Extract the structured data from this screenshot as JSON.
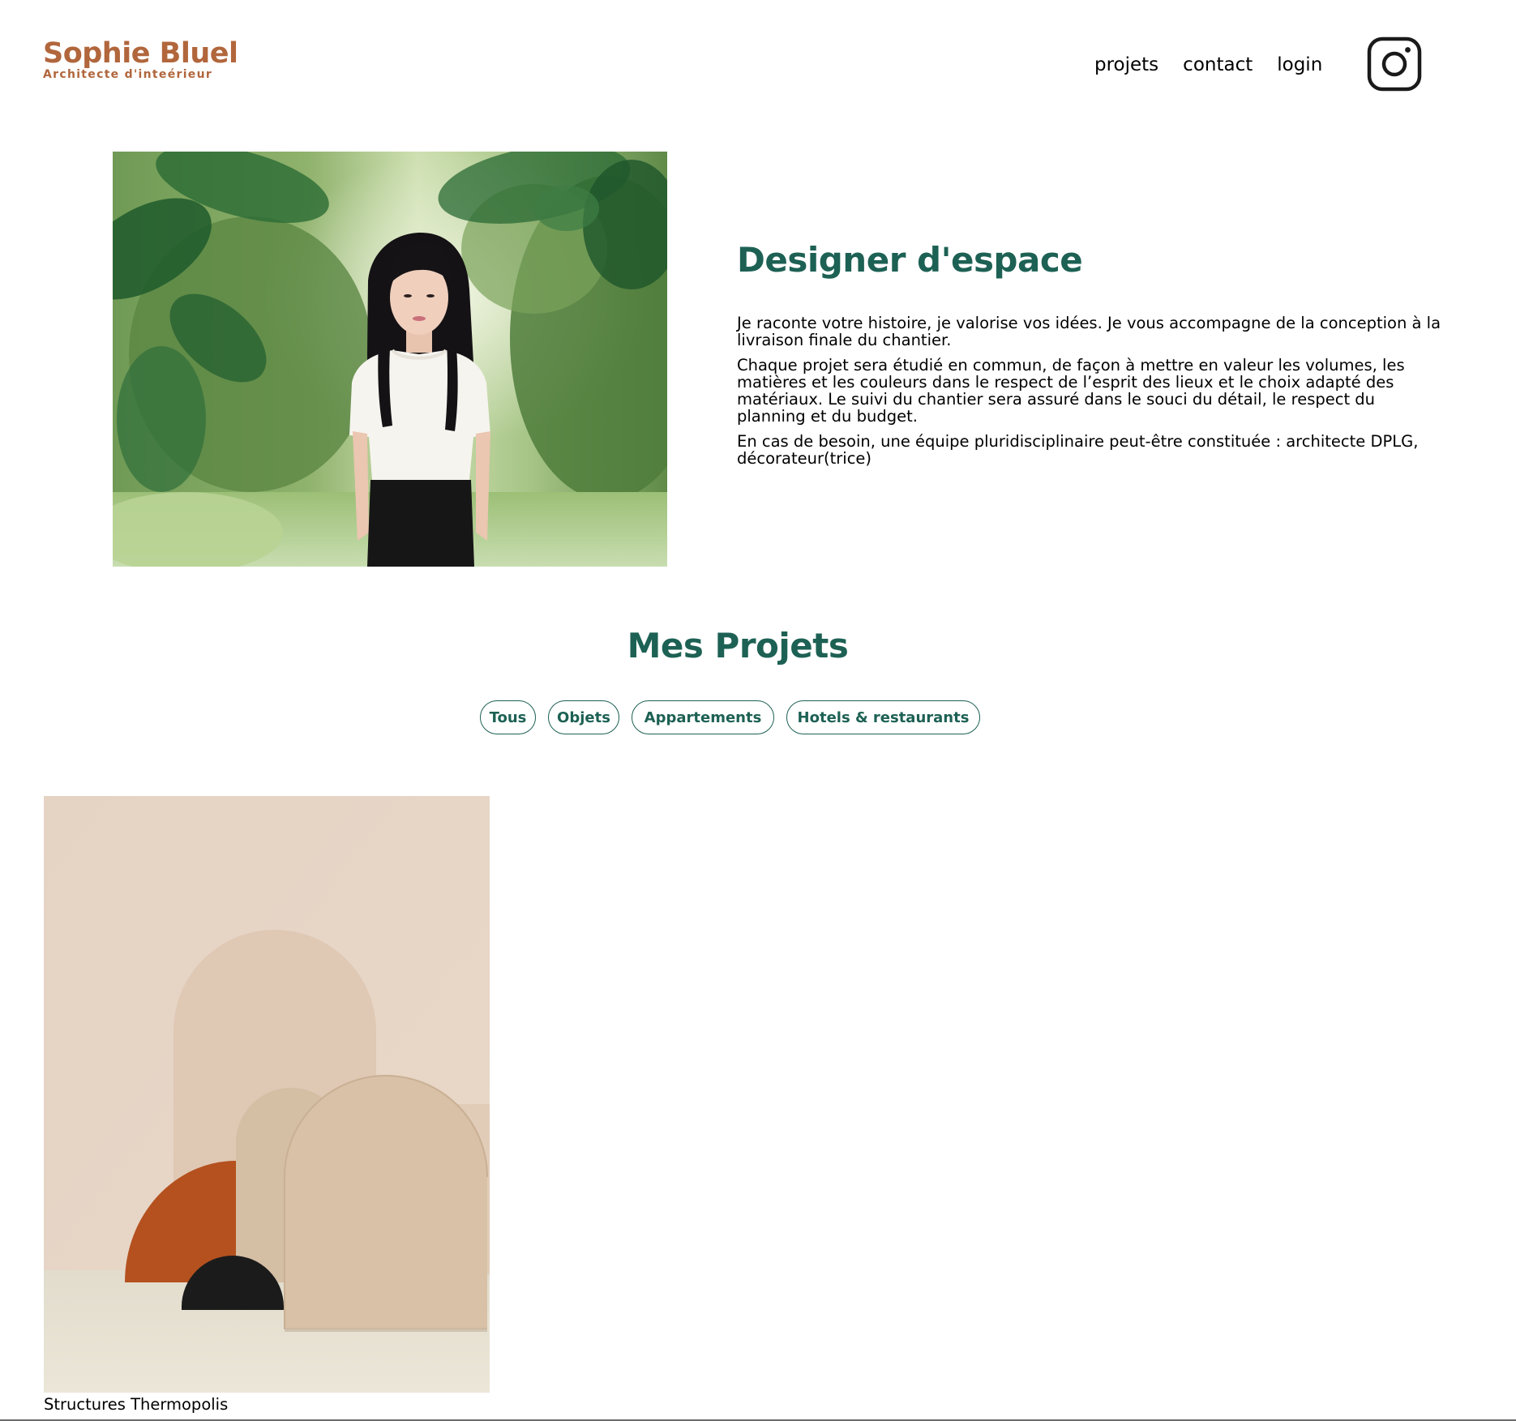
{
  "header": {
    "logo_title": "Sophie Bluel",
    "logo_subtitle": "Architecte d'inteérieur",
    "nav": [
      {
        "label": "projets"
      },
      {
        "label": "contact"
      },
      {
        "label": "login"
      }
    ],
    "social_icon": "instagram-icon"
  },
  "introduction": {
    "photo": "portrait-photo",
    "title": "Designer d'espace",
    "paragraphs": [
      "Je raconte votre histoire, je valorise vos idées. Je vous accompagne de la conception à la livraison finale du chantier.",
      "Chaque projet sera étudié en commun, de façon à mettre en valeur les volumes, les matières et les couleurs dans le respect de l’esprit des lieux et le choix adapté des matériaux. Le suivi du chantier sera assuré dans le souci du détail, le respect du planning et du budget.",
      "En cas de besoin, une équipe pluridisciplinaire peut-être constituée : architecte DPLG, décorateur(trice)"
    ]
  },
  "portfolio": {
    "title": "Mes Projets",
    "filters": [
      "Tous",
      "Objets",
      "Appartements",
      "Hotels & restaurants"
    ],
    "works": [
      {
        "caption": "Structures Thermopolis",
        "image": "arch-structures-photo"
      }
    ]
  },
  "colors": {
    "brand_orange": "#B1663C",
    "brand_green": "#1D6154",
    "text": "#000000",
    "background": "#FFFFFF"
  }
}
